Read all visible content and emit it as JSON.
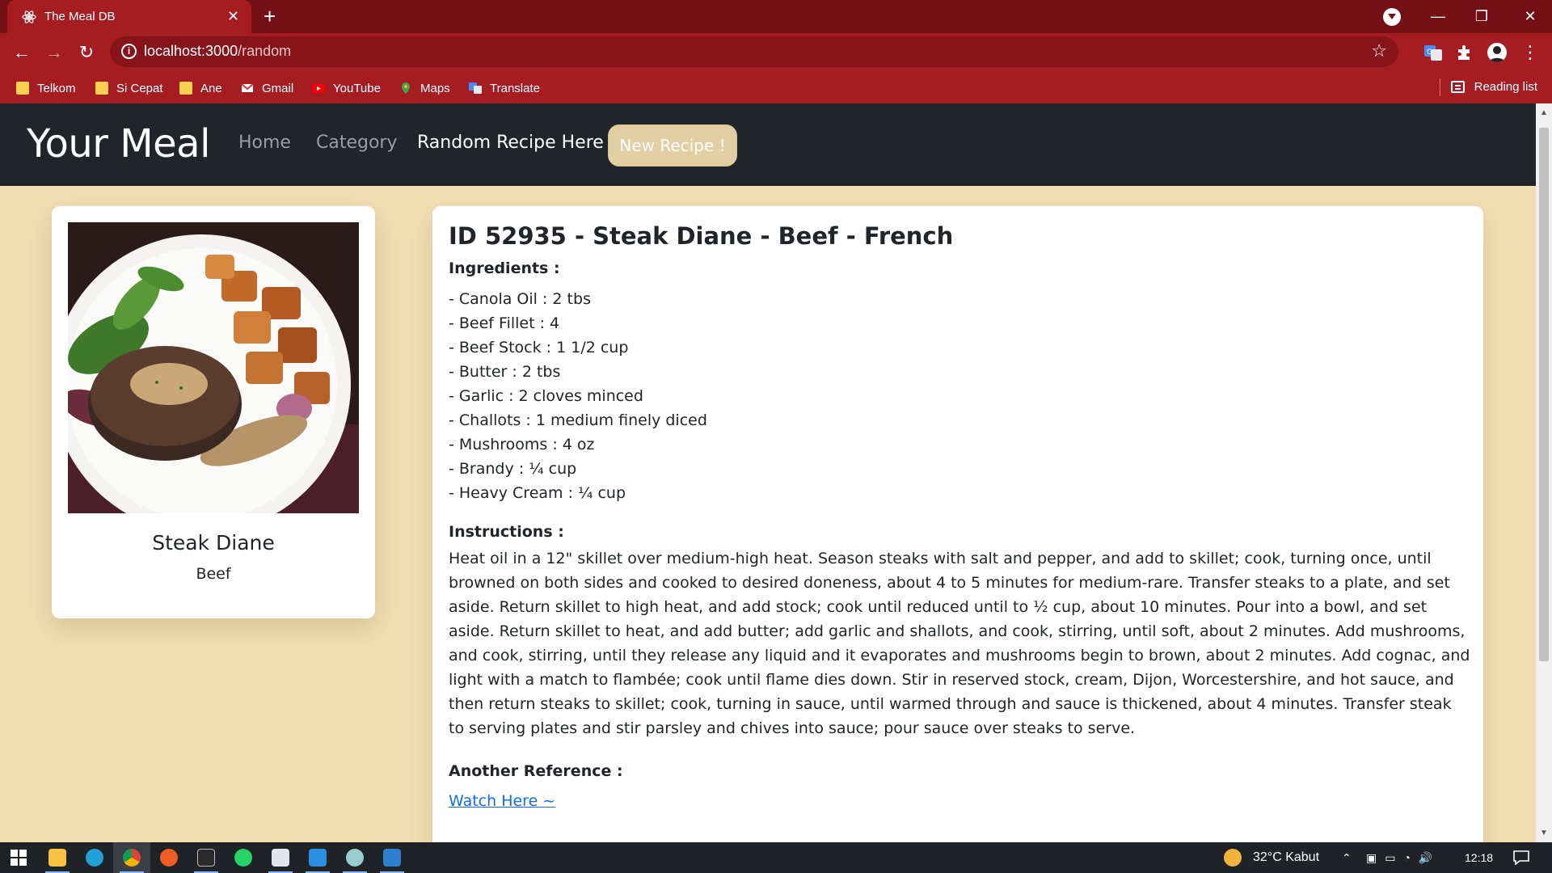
{
  "browser": {
    "tab_title": "The Meal DB",
    "tab_close": "✕",
    "new_tab": "+",
    "url_host": "localhost:3000",
    "url_path": "/random",
    "bookmarks": [
      "Telkom",
      "Si Cepat",
      "Ane",
      "Gmail",
      "YouTube",
      "Maps",
      "Translate"
    ],
    "reading_list": "Reading list",
    "window_controls": [
      "—",
      "❐",
      "✕"
    ]
  },
  "navbar": {
    "brand": "Your Meal",
    "links": [
      "Home",
      "Category",
      "Random Recipe Here !"
    ],
    "button": "New Recipe !"
  },
  "meal_card": {
    "name": "Steak Diane",
    "category": "Beef"
  },
  "recipe": {
    "title": "ID 52935 - Steak Diane - Beef - French",
    "ingredients_label": "Ingredients :",
    "ingredients": [
      "- Canola Oil : 2 tbs",
      "- Beef Fillet : 4",
      "- Beef Stock : 1 1/2 cup",
      "- Butter : 2 tbs",
      "- Garlic : 2 cloves minced",
      "- Challots : 1 medium finely diced",
      "- Mushrooms : 4 oz",
      "- Brandy : ¼ cup",
      "- Heavy Cream : ¼ cup"
    ],
    "instructions_label": "Instructions :",
    "instructions": "Heat oil in a 12\" skillet over medium-high heat. Season steaks with salt and pepper, and add to skillet; cook, turning once, until browned on both sides and cooked to desired doneness, about 4 to 5 minutes for medium-rare. Transfer steaks to a plate, and set aside. Return skillet to high heat, and add stock; cook until reduced until to ½ cup, about 10 minutes. Pour into a bowl, and set aside. Return skillet to heat, and add butter; add garlic and shallots, and cook, stirring, until soft, about 2 minutes. Add mushrooms, and cook, stirring, until they release any liquid and it evaporates and mushrooms begin to brown, about 2 minutes. Add cognac, and light with a match to flambée; cook until flame dies down. Stir in reserved stock, cream, Dijon, Worcestershire, and hot sauce, and then return steaks to skillet; cook, turning in sauce, until warmed through and sauce is thickened, about 4 minutes. Transfer steak to serving plates and stir parsley and chives into sauce; pour sauce over steaks to serve.",
    "reference_label": "Another Reference :",
    "reference_link": "Watch Here ~"
  },
  "taskbar": {
    "weather": "32°C  Kabut",
    "time": "12:18"
  },
  "colors": {
    "chrome_dark": "#741014",
    "chrome": "#a51c22",
    "page_bg": "#f1deb3",
    "navbar_bg": "#212529",
    "button_bg": "#e2cfa4",
    "link": "#0d6efd"
  }
}
